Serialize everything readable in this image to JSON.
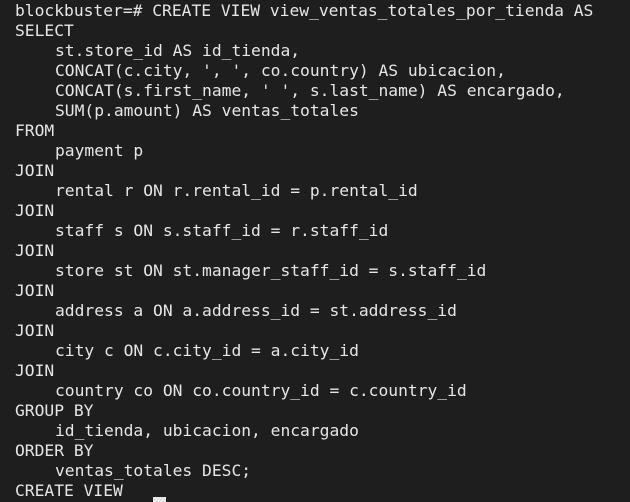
{
  "terminal": {
    "prompt_line": "blockbuster=# CREATE VIEW view_ventas_totales_por_tienda AS",
    "lines": [
      "SELECT",
      "st.store_id AS id_tienda,",
      "CONCAT(c.city, ', ', co.country) AS ubicacion,",
      "CONCAT(s.first_name, ' ', s.last_name) AS encargado,",
      "SUM(p.amount) AS ventas_totales",
      "FROM",
      "payment p",
      "JOIN",
      "rental r ON r.rental_id = p.rental_id",
      "JOIN",
      "staff s ON s.staff_id = r.staff_id",
      "JOIN",
      "store st ON st.manager_staff_id = s.staff_id",
      "JOIN",
      "address a ON a.address_id = st.address_id",
      "JOIN",
      "city c ON c.city_id = a.city_id",
      "JOIN",
      "country co ON co.country_id = c.country_id",
      "GROUP BY",
      "id_tienda, ubicacion, encargado",
      "ORDER BY",
      "ventas_totales DESC;",
      "CREATE VIEW"
    ]
  }
}
